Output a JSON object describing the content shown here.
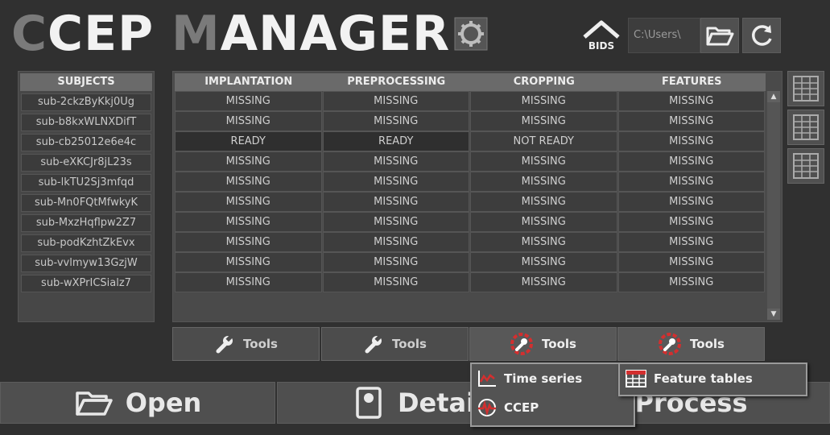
{
  "app": {
    "title_first": "C",
    "title_mid": "CEP ",
    "title_m": "M",
    "title_rest": "ANAGER"
  },
  "toolbar": {
    "bids_label": "BIDS",
    "path_value": "C:\\Users\\"
  },
  "subjects": {
    "header": "SUBJECTS",
    "items": [
      "sub-2ckzByKkj0Ug",
      "sub-b8kxWLNXDifT",
      "sub-cb25012e6e4c",
      "sub-eXKCJr8jL23s",
      "sub-lkTU2Sj3mfqd",
      "sub-Mn0FQtMfwkyK",
      "sub-MxzHqflpw2Z7",
      "sub-podKzhtZkEvx",
      "sub-vvlmyw13GzjW",
      "sub-wXPrICSialz7"
    ]
  },
  "table": {
    "columns": [
      "IMPLANTATION",
      "PREPROCESSING",
      "CROPPING",
      "FEATURES"
    ],
    "rows": [
      [
        "MISSING",
        "MISSING",
        "MISSING",
        "MISSING"
      ],
      [
        "MISSING",
        "MISSING",
        "MISSING",
        "MISSING"
      ],
      [
        "READY",
        "READY",
        "NOT READY",
        "MISSING"
      ],
      [
        "MISSING",
        "MISSING",
        "MISSING",
        "MISSING"
      ],
      [
        "MISSING",
        "MISSING",
        "MISSING",
        "MISSING"
      ],
      [
        "MISSING",
        "MISSING",
        "MISSING",
        "MISSING"
      ],
      [
        "MISSING",
        "MISSING",
        "MISSING",
        "MISSING"
      ],
      [
        "MISSING",
        "MISSING",
        "MISSING",
        "MISSING"
      ],
      [
        "MISSING",
        "MISSING",
        "MISSING",
        "MISSING"
      ],
      [
        "MISSING",
        "MISSING",
        "MISSING",
        "MISSING"
      ]
    ]
  },
  "tools": {
    "label": "Tools"
  },
  "menus": {
    "cropping_tools": [
      "Time series",
      "CCEP"
    ],
    "features_tools": [
      "Feature tables"
    ]
  },
  "actions": {
    "open_label": "Open",
    "details_label": "Detai",
    "process_label": "Process"
  },
  "colors": {
    "background": "#303030",
    "panel": "#4a4a4a",
    "header": "#6a6a6a",
    "accent_red": "#d32f2f"
  }
}
